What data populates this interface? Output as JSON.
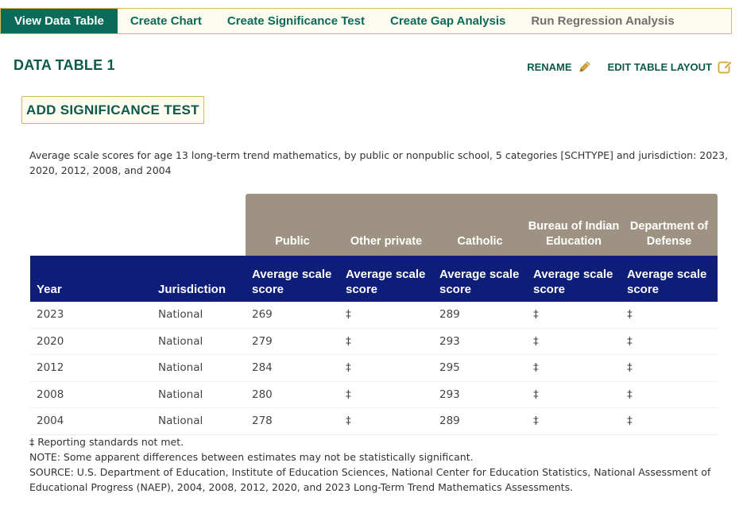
{
  "tabs": [
    {
      "label": "View Data Table",
      "state": "active"
    },
    {
      "label": "Create Chart",
      "state": "normal"
    },
    {
      "label": "Create Significance Test",
      "state": "normal"
    },
    {
      "label": "Create Gap Analysis",
      "state": "normal"
    },
    {
      "label": "Run Regression Analysis",
      "state": "disabled"
    }
  ],
  "page": {
    "title": "DATA TABLE 1",
    "rename_label": "RENAME",
    "edit_layout_label": "EDIT TABLE LAYOUT",
    "add_significance_label": "ADD SIGNIFICANCE TEST",
    "description": "Average scale scores for age 13 long-term trend mathematics, by public or nonpublic school, 5 categories [SCHTYPE] and jurisdiction: 2023, 2020, 2012, 2008, and 2004"
  },
  "icons": {
    "rename": "pencil-icon",
    "edit_layout": "edit-square-icon"
  },
  "colors": {
    "brand_green": "#0b6b58",
    "gold_border": "#d9b85b",
    "group_header_bg": "#9e9383",
    "column_header_bg": "#0d1d78"
  },
  "table": {
    "groups": [
      "Public",
      "Other private",
      "Catholic",
      "Bureau of Indian Education",
      "Department of Defense"
    ],
    "headers": {
      "year": "Year",
      "jurisdiction": "Jurisdiction",
      "measure": [
        "Average scale score",
        "Average scale score",
        "Average scale score",
        "Average scale score",
        "Average scale score"
      ]
    },
    "rows": [
      {
        "year": "2023",
        "jurisdiction": "National",
        "values": [
          "269",
          "‡",
          "289",
          "‡",
          "‡"
        ]
      },
      {
        "year": "2020",
        "jurisdiction": "National",
        "values": [
          "279",
          "‡",
          "293",
          "‡",
          "‡"
        ]
      },
      {
        "year": "2012",
        "jurisdiction": "National",
        "values": [
          "284",
          "‡",
          "295",
          "‡",
          "‡"
        ]
      },
      {
        "year": "2008",
        "jurisdiction": "National",
        "values": [
          "280",
          "‡",
          "293",
          "‡",
          "‡"
        ]
      },
      {
        "year": "2004",
        "jurisdiction": "National",
        "values": [
          "278",
          "‡",
          "289",
          "‡",
          "‡"
        ]
      }
    ]
  },
  "notes": {
    "reporting": "‡ Reporting standards not met.",
    "note": "NOTE: Some apparent differences between estimates may not be statistically significant.",
    "source": "SOURCE: U.S. Department of Education, Institute of Education Sciences, National Center for Education Statistics, National Assessment of Educational Progress (NAEP), 2004, 2008, 2012, 2020, and 2023 Long-Term Trend Mathematics Assessments."
  }
}
